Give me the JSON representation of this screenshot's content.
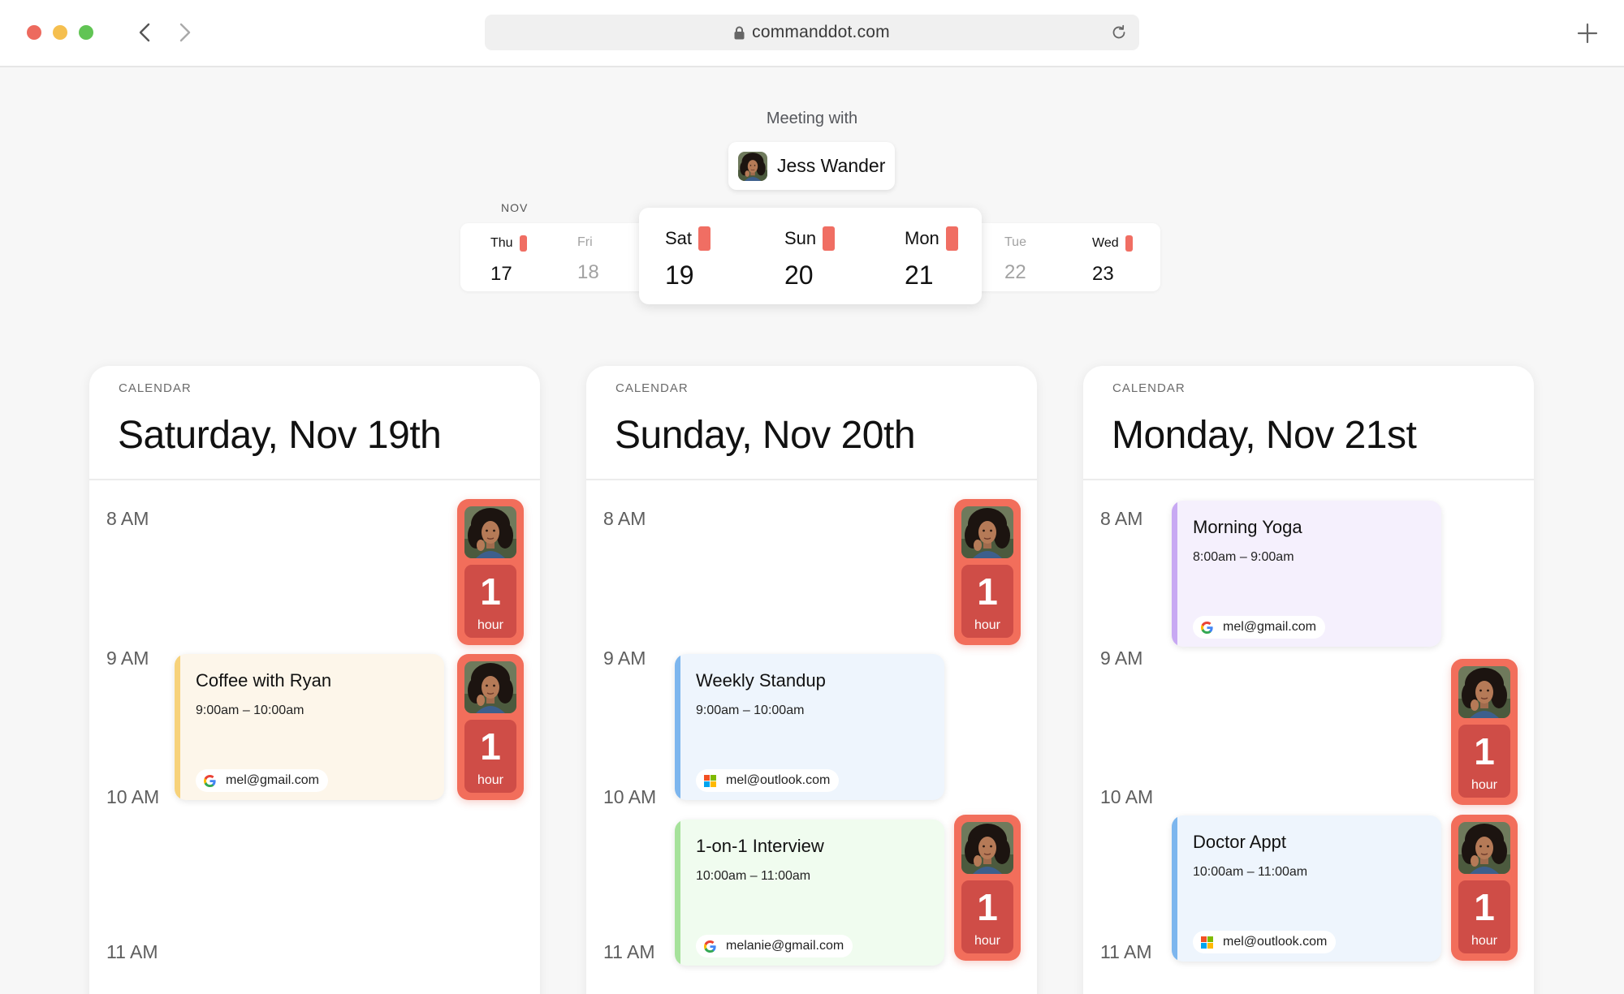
{
  "browser": {
    "url": "commanddot.com"
  },
  "header": {
    "meeting_label": "Meeting with",
    "person_name": "Jess Wander",
    "month": "NOV"
  },
  "day_strip": [
    {
      "name": "Thu",
      "num": "17",
      "available": true,
      "focused": false,
      "muted": false
    },
    {
      "name": "Fri",
      "num": "18",
      "available": false,
      "focused": false,
      "muted": true
    },
    {
      "name": "Sat",
      "num": "19",
      "available": true,
      "focused": true,
      "muted": false
    },
    {
      "name": "Sun",
      "num": "20",
      "available": true,
      "focused": true,
      "muted": false
    },
    {
      "name": "Mon",
      "num": "21",
      "available": true,
      "focused": true,
      "muted": false
    },
    {
      "name": "Tue",
      "num": "22",
      "available": false,
      "focused": false,
      "muted": true
    },
    {
      "name": "Wed",
      "num": "23",
      "available": true,
      "focused": false,
      "muted": false
    }
  ],
  "colors": {
    "accent": "#f26e5b",
    "accent_dark": "#cf4d47"
  },
  "calendars": [
    {
      "label": "CALENDAR",
      "title": "Saturday, Nov 19th",
      "times": [
        "8 AM",
        "9 AM",
        "10 AM",
        "11 AM"
      ],
      "events": [
        {
          "title": "Coffee with Ryan",
          "time": "9:00am – 10:00am",
          "account": "mel@gmail.com",
          "provider": "google",
          "color": "#fdf6ea",
          "bar": "#f7d27a"
        }
      ],
      "slots": [
        {
          "number": "1",
          "unit": "hour"
        },
        {
          "number": "1",
          "unit": "hour"
        }
      ]
    },
    {
      "label": "CALENDAR",
      "title": "Sunday, Nov 20th",
      "times": [
        "8 AM",
        "9 AM",
        "10 AM",
        "11 AM"
      ],
      "events": [
        {
          "title": "Weekly Standup",
          "time": "9:00am – 10:00am",
          "account": "mel@outlook.com",
          "provider": "microsoft",
          "color": "#eef5fd",
          "bar": "#7db6ee"
        },
        {
          "title": "1-on-1 Interview",
          "time": "10:00am – 11:00am",
          "account": "melanie@gmail.com",
          "provider": "google",
          "color": "#f0fcef",
          "bar": "#a6e29b"
        }
      ],
      "slots": [
        {
          "number": "1",
          "unit": "hour"
        },
        {
          "number": "1",
          "unit": "hour"
        }
      ]
    },
    {
      "label": "CALENDAR",
      "title": "Monday, Nov 21st",
      "times": [
        "8 AM",
        "9 AM",
        "10 AM",
        "11 AM"
      ],
      "events": [
        {
          "title": "Morning Yoga",
          "time": "8:00am – 9:00am",
          "account": "mel@gmail.com",
          "provider": "google",
          "color": "#f5f0fd",
          "bar": "#c8a9f3"
        },
        {
          "title": "Doctor Appt",
          "time": "10:00am – 11:00am",
          "account": "mel@outlook.com",
          "provider": "microsoft",
          "color": "#eef5fd",
          "bar": "#7db6ee"
        }
      ],
      "slots": [
        {
          "number": "1",
          "unit": "hour"
        },
        {
          "number": "1",
          "unit": "hour"
        }
      ]
    }
  ]
}
